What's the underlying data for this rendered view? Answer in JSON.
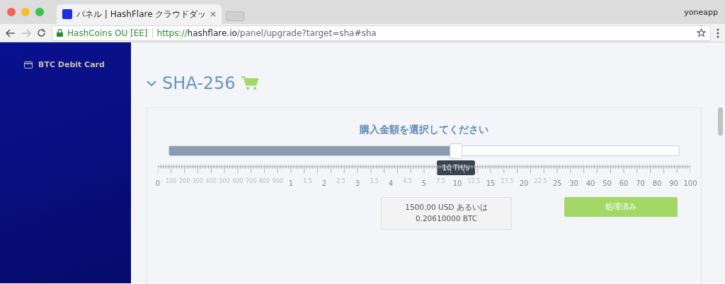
{
  "browser": {
    "tab_title": "パネル | HashFlare クラウドダッ",
    "user": "yoneapp",
    "site_identity": "HashCoins OU [EE]",
    "url_scheme": "https://",
    "url_host": "hashflare.io",
    "url_path": "/panel/upgrade?target=sha#sha"
  },
  "sidebar": {
    "items": [
      {
        "label": "BTC Debit Card"
      }
    ]
  },
  "section": {
    "title": "SHA-256",
    "expanded": true
  },
  "purchase": {
    "title": "購入金額を選択してください",
    "slider": {
      "level": 0.562,
      "tooltip": "10 TH/s"
    },
    "scale": [
      {
        "labels": [
          {
            "text": "0",
            "major": true
          },
          {
            "text": "100",
            "major": false
          },
          {
            "text": "200",
            "major": false
          },
          {
            "text": "300",
            "major": false
          },
          {
            "text": "400",
            "major": false
          },
          {
            "text": "500",
            "major": false
          },
          {
            "text": "600",
            "major": false
          },
          {
            "text": "700",
            "major": false
          },
          {
            "text": "800",
            "major": false
          },
          {
            "text": "900",
            "major": false
          }
        ]
      },
      {
        "labels": [
          {
            "text": "1",
            "major": true
          },
          {
            "text": "1.5",
            "major": false
          },
          {
            "text": "2",
            "major": true
          },
          {
            "text": "2.5",
            "major": false
          },
          {
            "text": "3",
            "major": true
          },
          {
            "text": "3.5",
            "major": false
          },
          {
            "text": "4",
            "major": true
          },
          {
            "text": "4.5",
            "major": false
          }
        ]
      },
      {
        "labels": [
          {
            "text": "5",
            "major": true
          },
          {
            "text": "7.5",
            "major": false
          },
          {
            "text": "10",
            "major": true
          },
          {
            "text": "12.5",
            "major": false
          },
          {
            "text": "15",
            "major": true
          },
          {
            "text": "17.5",
            "major": false
          },
          {
            "text": "20",
            "major": true
          },
          {
            "text": "22.5",
            "major": false
          }
        ]
      },
      {
        "labels": [
          {
            "text": "25",
            "major": true
          },
          {
            "text": "30",
            "major": true
          },
          {
            "text": "40",
            "major": true
          },
          {
            "text": "50",
            "major": true
          },
          {
            "text": "60",
            "major": true
          },
          {
            "text": "70",
            "major": true
          },
          {
            "text": "80",
            "major": true
          },
          {
            "text": "90",
            "major": true
          },
          {
            "text": "100",
            "major": true
          }
        ]
      }
    ],
    "price_line1": "1500.00 USD あるいは",
    "price_line2": "0.20610000 BTC",
    "button": "処理済み"
  }
}
